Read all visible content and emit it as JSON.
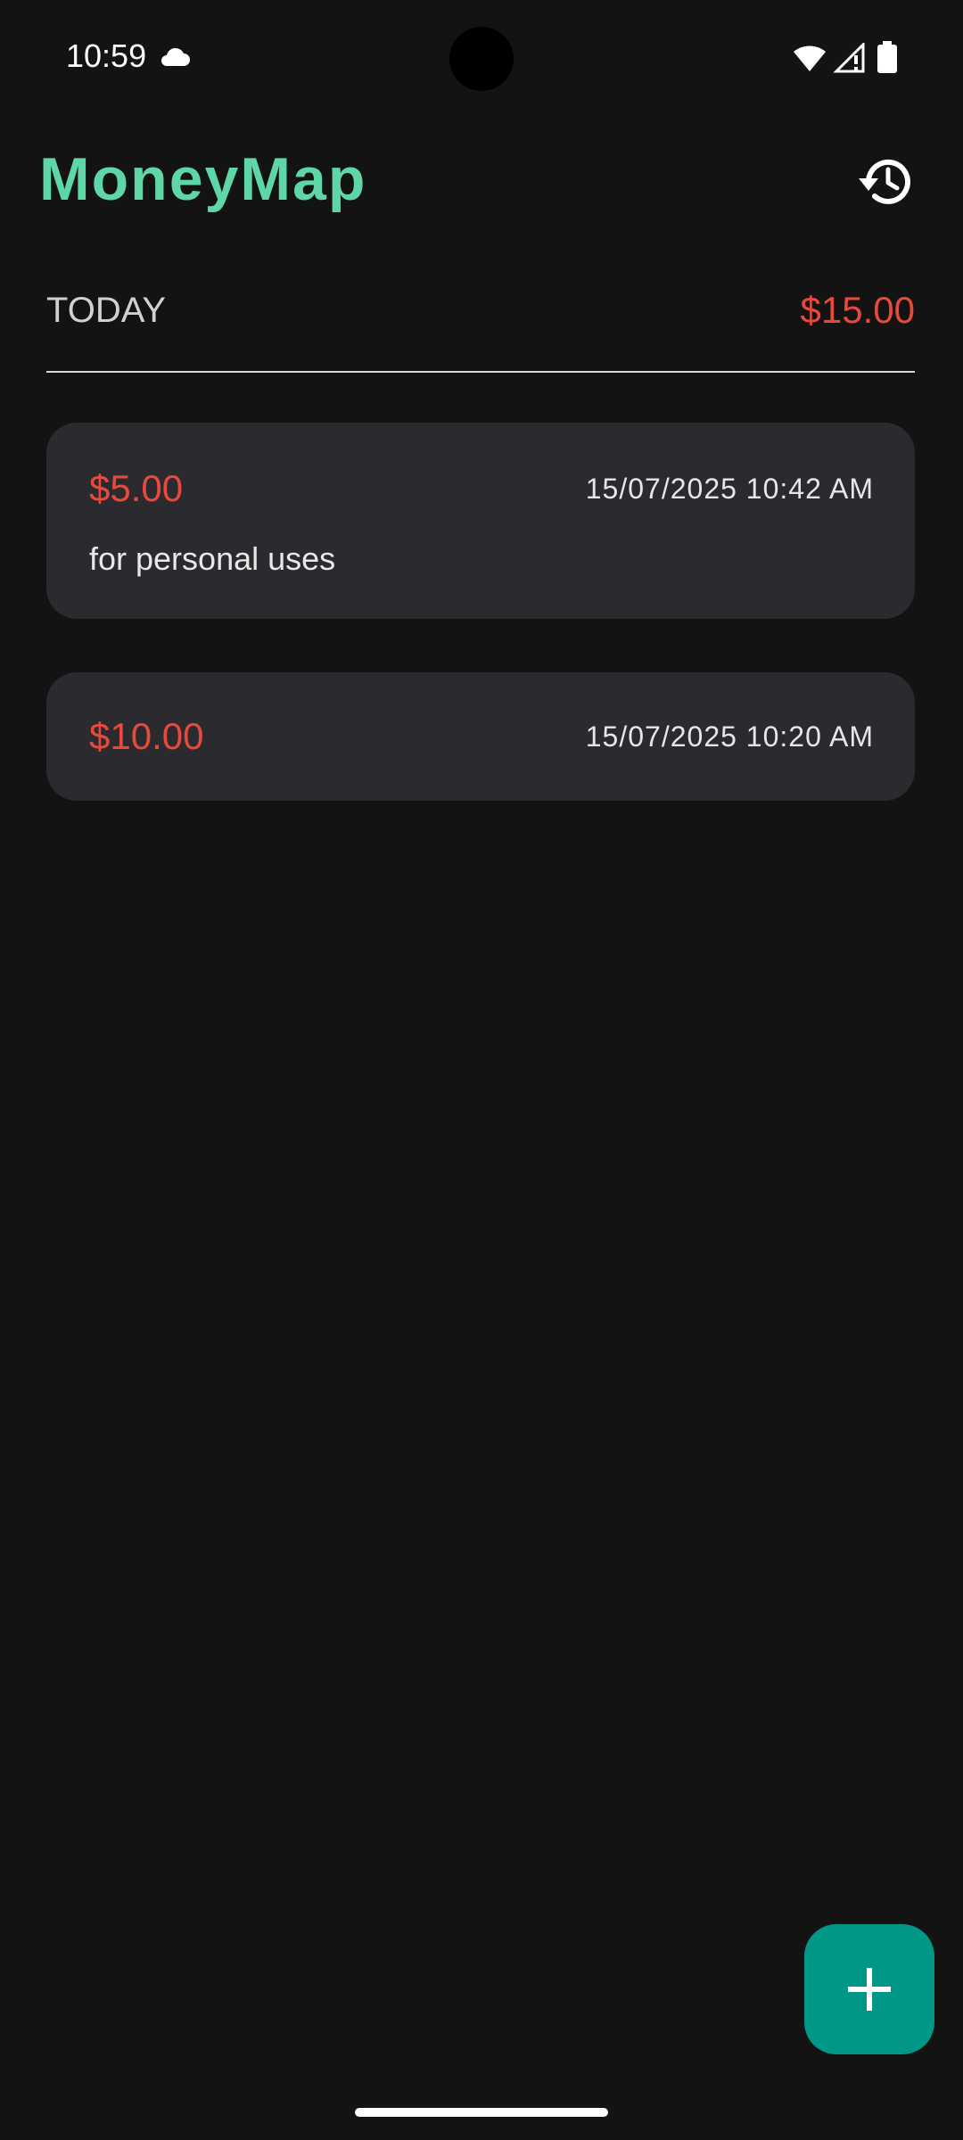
{
  "status_bar": {
    "time": "10:59"
  },
  "header": {
    "app_title": "MoneyMap",
    "history_icon": "history-icon"
  },
  "summary": {
    "label": "TODAY",
    "total": "$15.00"
  },
  "transactions": [
    {
      "amount": "$5.00",
      "datetime": "15/07/2025 10:42 AM",
      "note": "for personal uses"
    },
    {
      "amount": "$10.00",
      "datetime": "15/07/2025 10:20 AM"
    }
  ],
  "fab": {
    "icon": "plus-icon"
  },
  "colors": {
    "accent": "#5ed6a8",
    "expense": "#e7493d",
    "fab": "#009688",
    "card": "#2a2a2f",
    "background": "#131313"
  }
}
